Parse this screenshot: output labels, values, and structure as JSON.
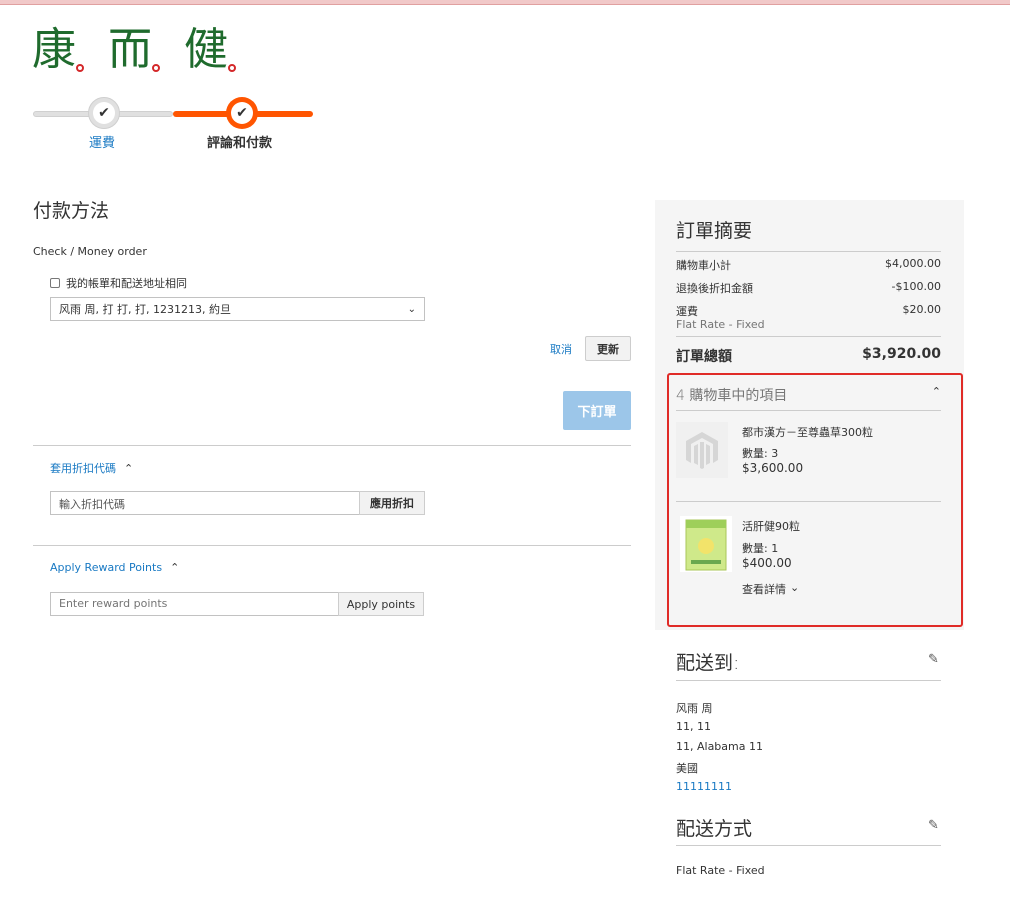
{
  "logo": {
    "chars": [
      "康",
      "而",
      "健"
    ]
  },
  "progress": {
    "step1_label": "運費",
    "step2_label": "評論和付款"
  },
  "payment": {
    "title": "付款方法",
    "method": "Check / Money order",
    "same_address_label": "我的帳單和配送地址相同",
    "address_selected": "风雨 周, 打 打, 打, 1231213, 約旦",
    "cancel_label": "取消",
    "update_label": "更新",
    "place_order_label": "下訂單"
  },
  "discount": {
    "title": "套用折扣代碼",
    "placeholder": "輸入折扣代碼",
    "apply_label": "應用折扣"
  },
  "reward": {
    "title": "Apply Reward Points",
    "placeholder": "Enter reward points",
    "apply_label": "Apply points"
  },
  "summary": {
    "title": "訂單摘要",
    "subtotal_label": "購物車小計",
    "subtotal_value": "$4,000.00",
    "discount_label": "退換後折扣金額",
    "discount_value": "-$100.00",
    "shipping_label": "運費",
    "shipping_value": "$20.00",
    "shipping_method": "Flat Rate - Fixed",
    "total_label": "訂單總額",
    "total_value": "$3,920.00",
    "items_header": "4 購物車中的項目",
    "items": [
      {
        "name": "都市漢方－至尊蟲草300粒",
        "qty": "數量: 3",
        "price": "$3,600.00"
      },
      {
        "name": "活肝健90粒",
        "qty": "數量: 1",
        "price": "$400.00"
      }
    ],
    "view_details": "查看詳情"
  },
  "ship_to": {
    "title": "配送到:",
    "lines": [
      "风雨 周",
      "11, 11",
      "11, Alabama 11",
      "美國"
    ],
    "phone": "11111111"
  },
  "ship_method": {
    "title": "配送方式",
    "value": "Flat Rate - Fixed"
  },
  "colors": {
    "accent": "#ff5501",
    "link": "#1979c3",
    "highlight": "#e02b27",
    "brand_green": "#1f6b2d"
  }
}
